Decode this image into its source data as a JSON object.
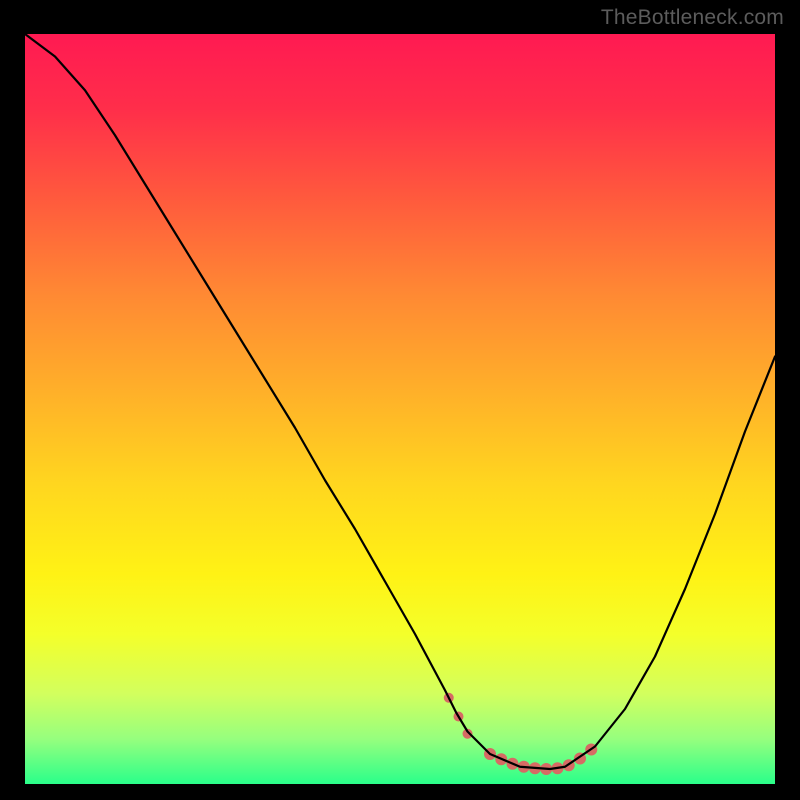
{
  "attribution": "TheBottleneck.com",
  "chart_data": {
    "type": "line",
    "title": "",
    "xlabel": "",
    "ylabel": "",
    "xlim": [
      0,
      100
    ],
    "ylim": [
      0,
      100
    ],
    "gradient_stops": [
      {
        "offset": 0.0,
        "color": "#ff1a52"
      },
      {
        "offset": 0.1,
        "color": "#ff2e4a"
      },
      {
        "offset": 0.22,
        "color": "#ff5a3d"
      },
      {
        "offset": 0.35,
        "color": "#ff8a33"
      },
      {
        "offset": 0.48,
        "color": "#ffb129"
      },
      {
        "offset": 0.6,
        "color": "#ffd61f"
      },
      {
        "offset": 0.72,
        "color": "#fff215"
      },
      {
        "offset": 0.8,
        "color": "#f4ff2a"
      },
      {
        "offset": 0.88,
        "color": "#d2ff5e"
      },
      {
        "offset": 0.94,
        "color": "#96ff7e"
      },
      {
        "offset": 1.0,
        "color": "#2aff8a"
      }
    ],
    "series": [
      {
        "name": "bottleneck-curve",
        "stroke": "#000000",
        "stroke_width": 2.2,
        "x": [
          0,
          4,
          8,
          12,
          16,
          20,
          24,
          28,
          32,
          36,
          40,
          44,
          48,
          52,
          56,
          57.5,
          59,
          62,
          66,
          70,
          72,
          76,
          80,
          84,
          88,
          92,
          96,
          100
        ],
        "y": [
          100,
          97,
          92.5,
          86.5,
          80,
          73.5,
          67,
          60.5,
          54,
          47.5,
          40.5,
          34,
          27,
          20,
          12.5,
          9.5,
          7,
          4,
          2.3,
          2,
          2.3,
          5,
          10,
          17,
          26,
          36,
          47,
          57
        ]
      }
    ],
    "markers": {
      "name": "highlight-range",
      "color": "#d66b64",
      "points": [
        {
          "x": 56.5,
          "y": 11.5,
          "r": 5
        },
        {
          "x": 57.8,
          "y": 9.0,
          "r": 5
        },
        {
          "x": 59.0,
          "y": 6.7,
          "r": 5
        },
        {
          "x": 62.0,
          "y": 4.0,
          "r": 6
        },
        {
          "x": 63.5,
          "y": 3.3,
          "r": 6
        },
        {
          "x": 65.0,
          "y": 2.7,
          "r": 6
        },
        {
          "x": 66.5,
          "y": 2.3,
          "r": 6
        },
        {
          "x": 68.0,
          "y": 2.1,
          "r": 6
        },
        {
          "x": 69.5,
          "y": 2.0,
          "r": 6
        },
        {
          "x": 71.0,
          "y": 2.1,
          "r": 6
        },
        {
          "x": 72.5,
          "y": 2.5,
          "r": 6
        },
        {
          "x": 74.0,
          "y": 3.4,
          "r": 6
        },
        {
          "x": 75.5,
          "y": 4.6,
          "r": 6
        }
      ]
    }
  }
}
